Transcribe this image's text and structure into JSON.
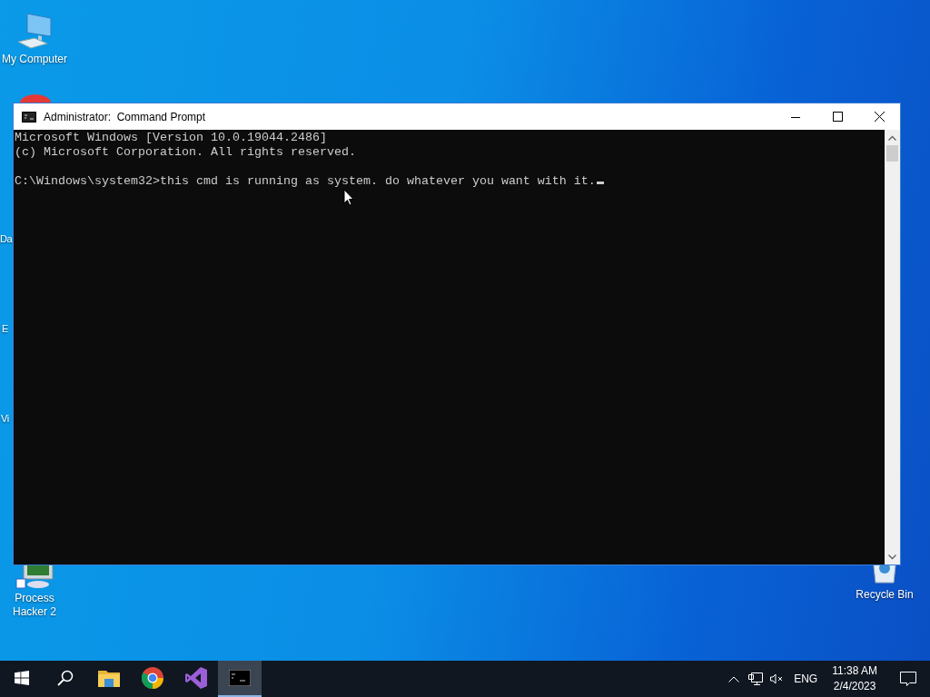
{
  "desktop_icons": [
    {
      "kind": "computer",
      "label": "My Computer"
    },
    {
      "kind": "covered",
      "label": "Da"
    },
    {
      "kind": "covered",
      "label": "E"
    },
    {
      "kind": "covered",
      "label": "Vi"
    },
    {
      "kind": "monitor",
      "label": "Process Hacker 2"
    },
    {
      "kind": "bin",
      "label": "Recycle Bin"
    }
  ],
  "window": {
    "title": "Administrator:  Command Prompt",
    "blocks": [
      [
        "Microsoft Windows [Version 10.0.19044.2486]",
        "(c) Microsoft Corporation. All rights reserved."
      ],
      [
        "C:\\Windows\\system32>this cmd is running as system. do whatever you want with it."
      ]
    ],
    "cursor": true
  },
  "taskbar": {
    "apps": [
      {
        "kind": "search",
        "selected": false
      },
      {
        "kind": "folder",
        "selected": false
      },
      {
        "kind": "browser",
        "selected": false
      },
      {
        "kind": "studio",
        "selected": false
      },
      {
        "kind": "console",
        "selected": true
      }
    ],
    "language": "ENG",
    "time": "11:38 AM",
    "date": "2/4/2023"
  }
}
